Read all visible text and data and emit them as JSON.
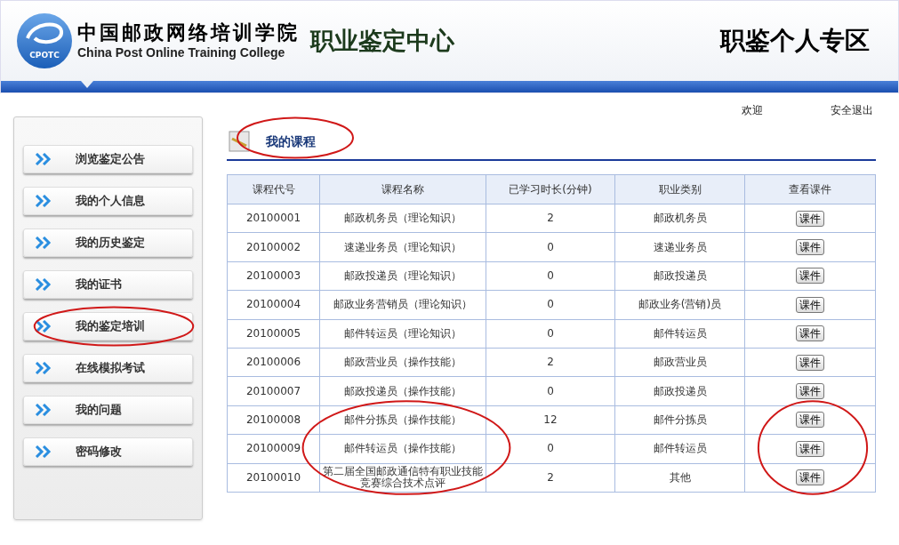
{
  "header": {
    "logo_badge": "CPOTC",
    "college_name_cn": "中国邮政网络培训学院",
    "college_name_en": "China Post Online Training College",
    "center_title": "职业鉴定中心",
    "zone_title": "职鉴个人专区"
  },
  "user_links": [
    {
      "label": "欢迎"
    },
    {
      "label": "安全退出"
    }
  ],
  "sidebar": {
    "items": [
      {
        "label": "浏览鉴定公告",
        "circled": false
      },
      {
        "label": "我的个人信息",
        "circled": false
      },
      {
        "label": "我的历史鉴定",
        "circled": false
      },
      {
        "label": "我的证书",
        "circled": false
      },
      {
        "label": "我的鉴定培训",
        "circled": true
      },
      {
        "label": "在线模拟考试",
        "circled": false
      },
      {
        "label": "我的问题",
        "circled": false
      },
      {
        "label": "密码修改",
        "circled": false
      }
    ]
  },
  "section": {
    "title": "我的课程",
    "circled": true
  },
  "table": {
    "columns": [
      "课程代号",
      "课程名称",
      "已学习时长(分钟)",
      "职业类别",
      "查看课件"
    ],
    "rows": [
      {
        "code": "20100001",
        "name": "邮政机务员（理论知识）",
        "minutes": "2",
        "category": "邮政机务员",
        "button": "课件",
        "name_circled": false,
        "button_circled": false
      },
      {
        "code": "20100002",
        "name": "速递业务员（理论知识）",
        "minutes": "0",
        "category": "速递业务员",
        "button": "课件",
        "name_circled": false,
        "button_circled": false
      },
      {
        "code": "20100003",
        "name": "邮政投递员（理论知识）",
        "minutes": "0",
        "category": "邮政投递员",
        "button": "课件",
        "name_circled": false,
        "button_circled": false
      },
      {
        "code": "20100004",
        "name": "邮政业务营销员（理论知识）",
        "minutes": "0",
        "category": "邮政业务(营销)员",
        "button": "课件",
        "name_circled": false,
        "button_circled": false
      },
      {
        "code": "20100005",
        "name": "邮件转运员（理论知识）",
        "minutes": "0",
        "category": "邮件转运员",
        "button": "课件",
        "name_circled": false,
        "button_circled": false
      },
      {
        "code": "20100006",
        "name": "邮政营业员（操作技能）",
        "minutes": "2",
        "category": "邮政营业员",
        "button": "课件",
        "name_circled": false,
        "button_circled": false
      },
      {
        "code": "20100007",
        "name": "邮政投递员（操作技能）",
        "minutes": "0",
        "category": "邮政投递员",
        "button": "课件",
        "name_circled": false,
        "button_circled": false
      },
      {
        "code": "20100008",
        "name": "邮件分拣员（操作技能）",
        "minutes": "12",
        "category": "邮件分拣员",
        "button": "课件",
        "name_circled": true,
        "button_circled": true
      },
      {
        "code": "20100009",
        "name": "邮件转运员（操作技能）",
        "minutes": "0",
        "category": "邮件转运员",
        "button": "课件",
        "name_circled": true,
        "button_circled": true
      },
      {
        "code": "20100010",
        "name": "第二届全国邮政通信特有职业技能竞赛综合技术点评",
        "minutes": "2",
        "category": "其他",
        "button": "课件",
        "name_circled": true,
        "button_circled": true
      }
    ]
  }
}
